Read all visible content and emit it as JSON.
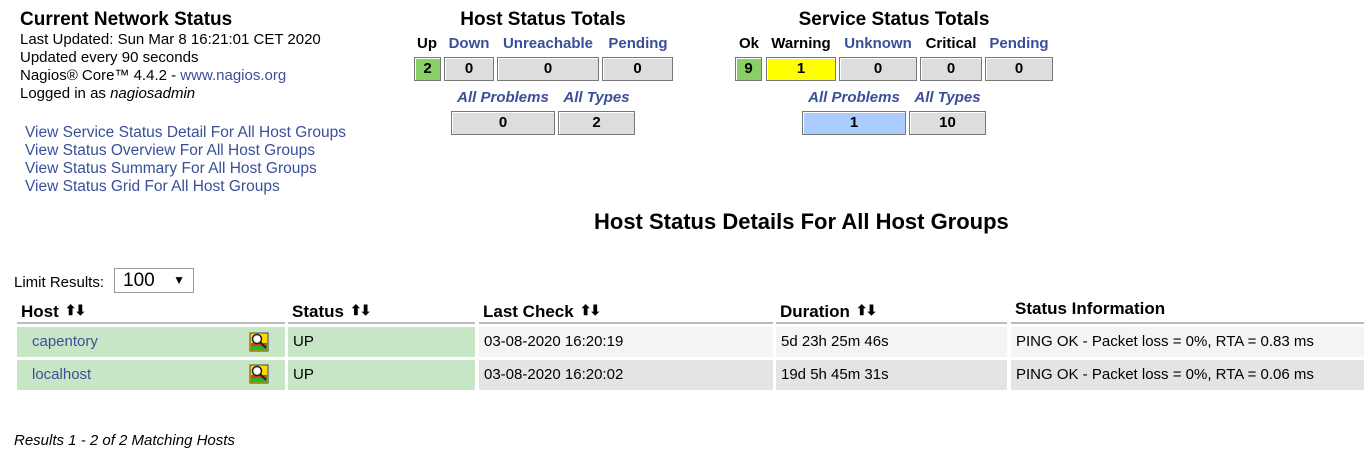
{
  "info": {
    "title": "Current Network Status",
    "last_updated": "Last Updated: Sun Mar 8 16:21:01 CET 2020",
    "update_interval": "Updated every 90 seconds",
    "core_prefix": "Nagios® Core™ 4.4.2 - ",
    "core_link": "www.nagios.org",
    "logged_in_prefix": "Logged in as ",
    "logged_in_user": "nagiosadmin"
  },
  "links": [
    "View Service Status Detail For All Host Groups",
    "View Status Overview For All Host Groups",
    "View Status Summary For All Host Groups",
    "View Status Grid For All Host Groups"
  ],
  "host_totals": {
    "title": "Host Status Totals",
    "up_label": "Up",
    "up": "2",
    "down_label": "Down",
    "down": "0",
    "unreachable_label": "Unreachable",
    "unreachable": "0",
    "pending_label": "Pending",
    "pending": "0",
    "all_problems_label": "All Problems",
    "all_problems": "0",
    "all_types_label": "All Types",
    "all_types": "2"
  },
  "service_totals": {
    "title": "Service Status Totals",
    "ok_label": "Ok",
    "ok": "9",
    "warning_label": "Warning",
    "warning": "1",
    "unknown_label": "Unknown",
    "unknown": "0",
    "critical_label": "Critical",
    "critical": "0",
    "pending_label": "Pending",
    "pending": "0",
    "all_problems_label": "All Problems",
    "all_problems": "1",
    "all_types_label": "All Types",
    "all_types": "10"
  },
  "details": {
    "title": "Host Status Details For All Host Groups",
    "limit_label": "Limit Results:",
    "limit_value": "100",
    "columns": [
      "Host",
      "Status",
      "Last Check",
      "Duration",
      "Status Information"
    ],
    "rows": [
      {
        "host": "capentory",
        "status": "UP",
        "last_check": "03-08-2020 16:20:19",
        "duration": "5d 23h 25m 46s",
        "info": "PING OK - Packet loss = 0%, RTA = 0.83 ms"
      },
      {
        "host": "localhost",
        "status": "UP",
        "last_check": "03-08-2020 16:20:02",
        "duration": "19d 5h 45m 31s",
        "info": "PING OK - Packet loss = 0%, RTA = 0.06 ms"
      }
    ],
    "results": "Results 1 - 2 of 2 Matching Hosts"
  },
  "colors": {
    "ok_green": "#88d066",
    "warning_yellow": "#ffff00",
    "problem_blue": "#aaccff",
    "row_green": "#c6e6c6",
    "link_blue": "#3a4f99"
  },
  "icons": {
    "sort": "sort-arrows-icon",
    "host_extinfo": "magnifier-status-map-icon",
    "dropdown": "chevron-down-icon"
  }
}
